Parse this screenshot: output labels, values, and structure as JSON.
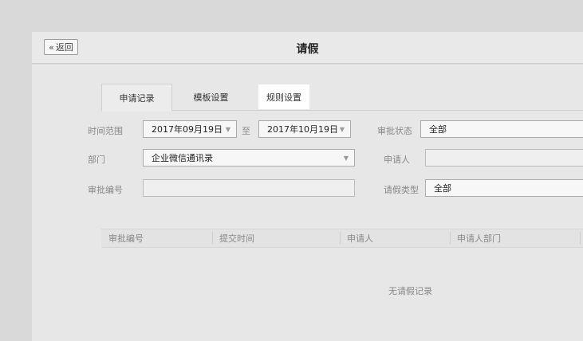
{
  "header": {
    "back_label": "返回",
    "title": "请假"
  },
  "tabs": [
    {
      "label": "申请记录",
      "state": "active"
    },
    {
      "label": "模板设置",
      "state": "normal"
    },
    {
      "label": "规则设置",
      "state": "highlighted"
    }
  ],
  "filters": {
    "time_range_label": "时间范围",
    "start_date": "2017年09月19日",
    "to_label": "至",
    "end_date": "2017年10月19日",
    "status_label": "审批状态",
    "status_value": "全部",
    "department_label": "部门",
    "department_value": "企业微信通讯录",
    "applicant_label": "申请人",
    "applicant_value": "",
    "approval_no_label": "审批编号",
    "approval_no_value": "",
    "leave_type_label": "请假类型",
    "leave_type_value": "全部"
  },
  "table": {
    "columns": [
      "审批编号",
      "提交时间",
      "申请人",
      "申请人部门"
    ],
    "empty_text": "无请假记录"
  }
}
